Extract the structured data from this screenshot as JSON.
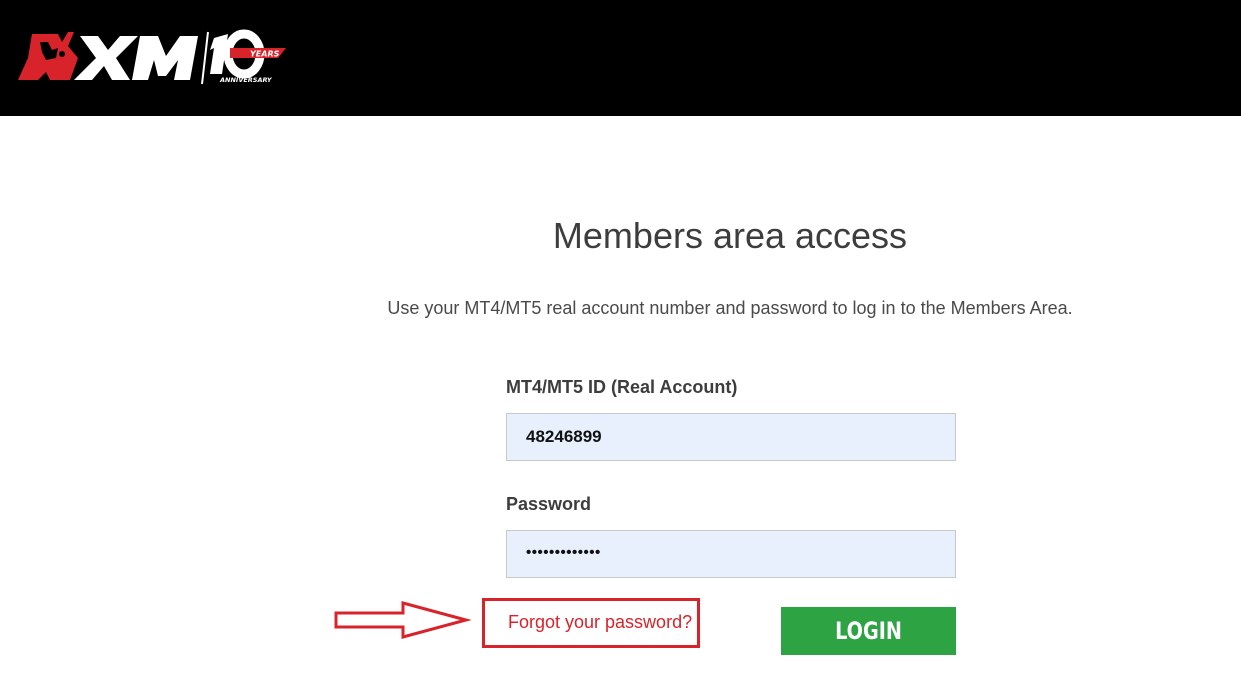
{
  "header": {
    "logo": {
      "brand_text": "XM",
      "badge_number": "10",
      "badge_years": "YEARS",
      "badge_anniversary": "ANNIVERSARY"
    }
  },
  "main": {
    "title": "Members area access",
    "subtitle": "Use your MT4/MT5 real account number and password to log in to the Members Area.",
    "account_field": {
      "label": "MT4/MT5 ID (Real Account)",
      "value": "48246899"
    },
    "password_field": {
      "label": "Password",
      "value": "•••••••••••••"
    },
    "forgot_link": "Forgot your password?",
    "login_button": "LOGIN"
  },
  "annotation": {
    "arrow_icon": "right-arrow-outline-icon",
    "highlight_color": "#d8232a"
  },
  "colors": {
    "header_bg": "#000000",
    "brand_red": "#d8232a",
    "login_green": "#2ea344",
    "input_bg": "#e8f0fe"
  }
}
